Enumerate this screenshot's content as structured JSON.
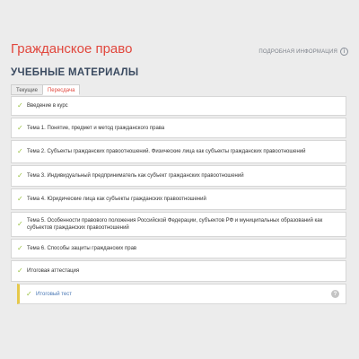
{
  "header": {
    "course_title": "Гражданское право",
    "more_info": "ПОДРОБНАЯ ИНФОРМАЦИЯ",
    "info_icon": "i"
  },
  "section_title": "УЧЕБНЫЕ МАТЕРИАЛЫ",
  "tabs": [
    {
      "label": "Текущие",
      "active": false
    },
    {
      "label": "Пересдача",
      "active": true
    }
  ],
  "materials": [
    {
      "label": "Введение в курс",
      "completed": true
    },
    {
      "label": "Тема 1. Понятие, предмет и метод гражданского права",
      "completed": true
    },
    {
      "label": "Тема 2. Субъекты гражданских правоотношений. Физические лица как субъекты гражданских правоотношений",
      "completed": true
    },
    {
      "label": "Тема 3. Индивидуальный предприниматель как субъект гражданских правоотношений",
      "completed": true
    },
    {
      "label": "Тема 4. Юридические лица как субъекты гражданских правоотношений",
      "completed": true
    },
    {
      "label": "Тема 5. Особенности правового положения Российской Федерации, субъектов РФ и муниципальных образований как субъектов гражданских правоотношений",
      "completed": true
    },
    {
      "label": "Тема 6. Способы защиты гражданских прав",
      "completed": true
    },
    {
      "label": "Итоговая аттестация",
      "completed": true
    }
  ],
  "final_test": {
    "label": "Итоговый тест",
    "completed": true,
    "help_icon": "?"
  },
  "colors": {
    "accent": "#e1473d",
    "check": "#9bc243",
    "link": "#4a78b5",
    "sub_border": "#e6c84a"
  }
}
